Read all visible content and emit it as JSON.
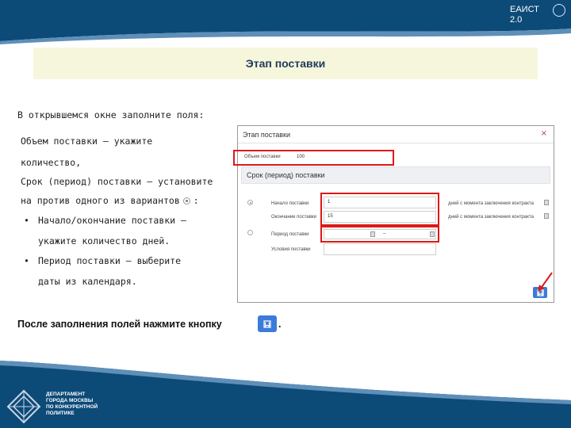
{
  "header": {
    "brand_line1": "ЕАИСТ",
    "brand_line2": "2.0"
  },
  "title": "Этап поставки",
  "instructions": {
    "intro": "В открывшемся окне заполните поля:",
    "line1": "Объем поставки – укажите",
    "line2": "количество,",
    "line3": "Срок (период) поставки – установите",
    "line4_pre": "на против одного из вариантов",
    "line4_post": ":",
    "bullet_char": "•",
    "bullet1_line1": "Начало/окончание поставки –",
    "bullet1_line2": "укажите количество дней.",
    "bullet2_line1": "Период поставки – выберите",
    "bullet2_line2": "даты из календаря."
  },
  "after_fill": {
    "text": "После заполнения полей нажмите кнопку",
    "dot": "."
  },
  "dialog": {
    "title": "Этап поставки",
    "close_glyph": "×",
    "volume_label": "Объем поставки",
    "volume_value": "100",
    "section_title": "Срок (период) поставки",
    "start_label": "Начало поставки",
    "start_value": "1",
    "start_note": "дней с момента заключения контракта",
    "end_label": "Окончание поставки",
    "end_value": "15",
    "end_note": "дней с момента заключения контракта",
    "period_label": "Период поставки",
    "period_separator": "–",
    "conditions_label": "Условия поставки"
  },
  "footer": {
    "dept_line1": "ДЕПАРТАМЕНТ",
    "dept_line2": "ГОРОДА МОСКВЫ",
    "dept_line3": "ПО КОНКУРЕНТНОЙ",
    "dept_line4": "ПОЛИТИКЕ"
  },
  "colors": {
    "banner": "#0c4a78",
    "title_bg": "#f6f6dd",
    "accent_red": "#e01818",
    "button_blue": "#3c7bd9"
  }
}
